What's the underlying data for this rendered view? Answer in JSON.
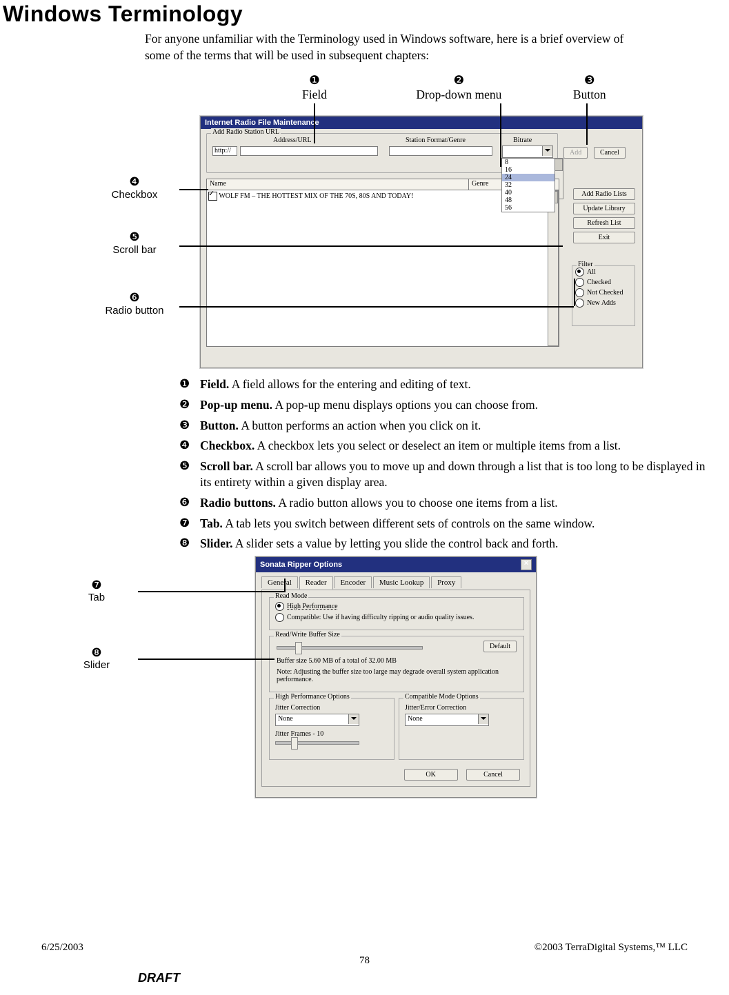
{
  "doc": {
    "title": "Windows Terminology",
    "intro": "For anyone unfamiliar with the Terminology used in Windows software, here is a brief overview of some of the terms that will be used in subsequent chapters:"
  },
  "callouts": {
    "top": [
      {
        "num": "❶",
        "label": "Field"
      },
      {
        "num": "❷",
        "label": "Drop-down menu"
      },
      {
        "num": "❸",
        "label": "Button"
      }
    ],
    "left": [
      {
        "num": "❹",
        "label": "Checkbox"
      },
      {
        "num": "❺",
        "label": "Scroll bar"
      },
      {
        "num": "❻",
        "label": "Radio button"
      }
    ],
    "fig2": [
      {
        "num": "❼",
        "label": "Tab"
      },
      {
        "num": "❽",
        "label": "Slider"
      }
    ]
  },
  "win1": {
    "title": "Internet Radio File Maintenance",
    "group1_caption": "Add Radio Station URL",
    "labels": {
      "address": "Address/URL",
      "format": "Station Format/Genre",
      "bitrate": "Bitrate"
    },
    "url_value": "http://",
    "add_btn": "Add",
    "cancel_btn": "Cancel",
    "bitrate_options": [
      "8",
      "16",
      "24",
      "32",
      "40",
      "48",
      "56"
    ],
    "table_headers": {
      "name": "Name",
      "genre": "Genre"
    },
    "row0": "WOLF FM – THE HOTTEST MIX OF THE 70S, 80S AND TODAY!",
    "side_buttons": {
      "addlists": "Add Radio Lists",
      "update": "Update Library",
      "refresh": "Refresh List",
      "exit": "Exit"
    },
    "filter_caption": "Filter",
    "filter": {
      "all": "All",
      "checked": "Checked",
      "notchecked": "Not Checked",
      "newadds": "New Adds"
    }
  },
  "definitions": [
    {
      "num": "❶",
      "term": "Field.",
      "desc": "  A field allows for the entering and editing of text."
    },
    {
      "num": "❷",
      "term": "Pop-up menu.",
      "desc": "  A pop-up menu displays options you can choose from."
    },
    {
      "num": "❸",
      "term": "Button.",
      "desc": "  A button performs an action when you click on it."
    },
    {
      "num": "❹",
      "term": "Checkbox.",
      "desc": "  A checkbox lets you select or deselect an item or multiple items from a list."
    },
    {
      "num": "❺",
      "term": "Scroll bar.",
      "desc": "  A scroll bar allows you to move up and down through a list that is too long to be displayed in its entirety within a given display area."
    },
    {
      "num": "❻",
      "term": "Radio buttons.",
      "desc": "   A radio button allows you to choose one items from a list."
    },
    {
      "num": "❼",
      "term": "Tab.",
      "desc": "   A tab lets you switch between different sets of controls on the same window."
    },
    {
      "num": "❽",
      "term": "Slider.",
      "desc": "   A slider sets a value by letting you slide the control back and forth."
    }
  ],
  "win2": {
    "title": "Sonata Ripper Options",
    "tabs": [
      "General",
      "Reader",
      "Encoder",
      "Music Lookup",
      "Proxy"
    ],
    "readmode_caption": "Read Mode",
    "readmode": {
      "hp": "High Performance",
      "compat": "Compatible: Use if having difficulty ripping or audio quality issues."
    },
    "buffer_caption": "Read/Write Buffer Size",
    "default_btn": "Default",
    "buffer_text": "Buffer size 5.60 MB of a total of 32.00 MB",
    "buffer_note": "Note: Adjusting the buffer size too large may degrade overall system application performance.",
    "hp_caption": "High Performance Options",
    "cm_caption": "Compatible Mode Options",
    "jc_label": "Jitter Correction",
    "jec_label": "Jitter/Error Correction",
    "none1": "None",
    "none2": "None",
    "jf_label": "Jitter Frames - 10",
    "ok": "OK",
    "cancel": "Cancel"
  },
  "footer": {
    "date": "6/25/2003",
    "copyright": "©2003 TerraDigital Systems,™ LLC",
    "page": "78",
    "draft": "DRAFT"
  }
}
